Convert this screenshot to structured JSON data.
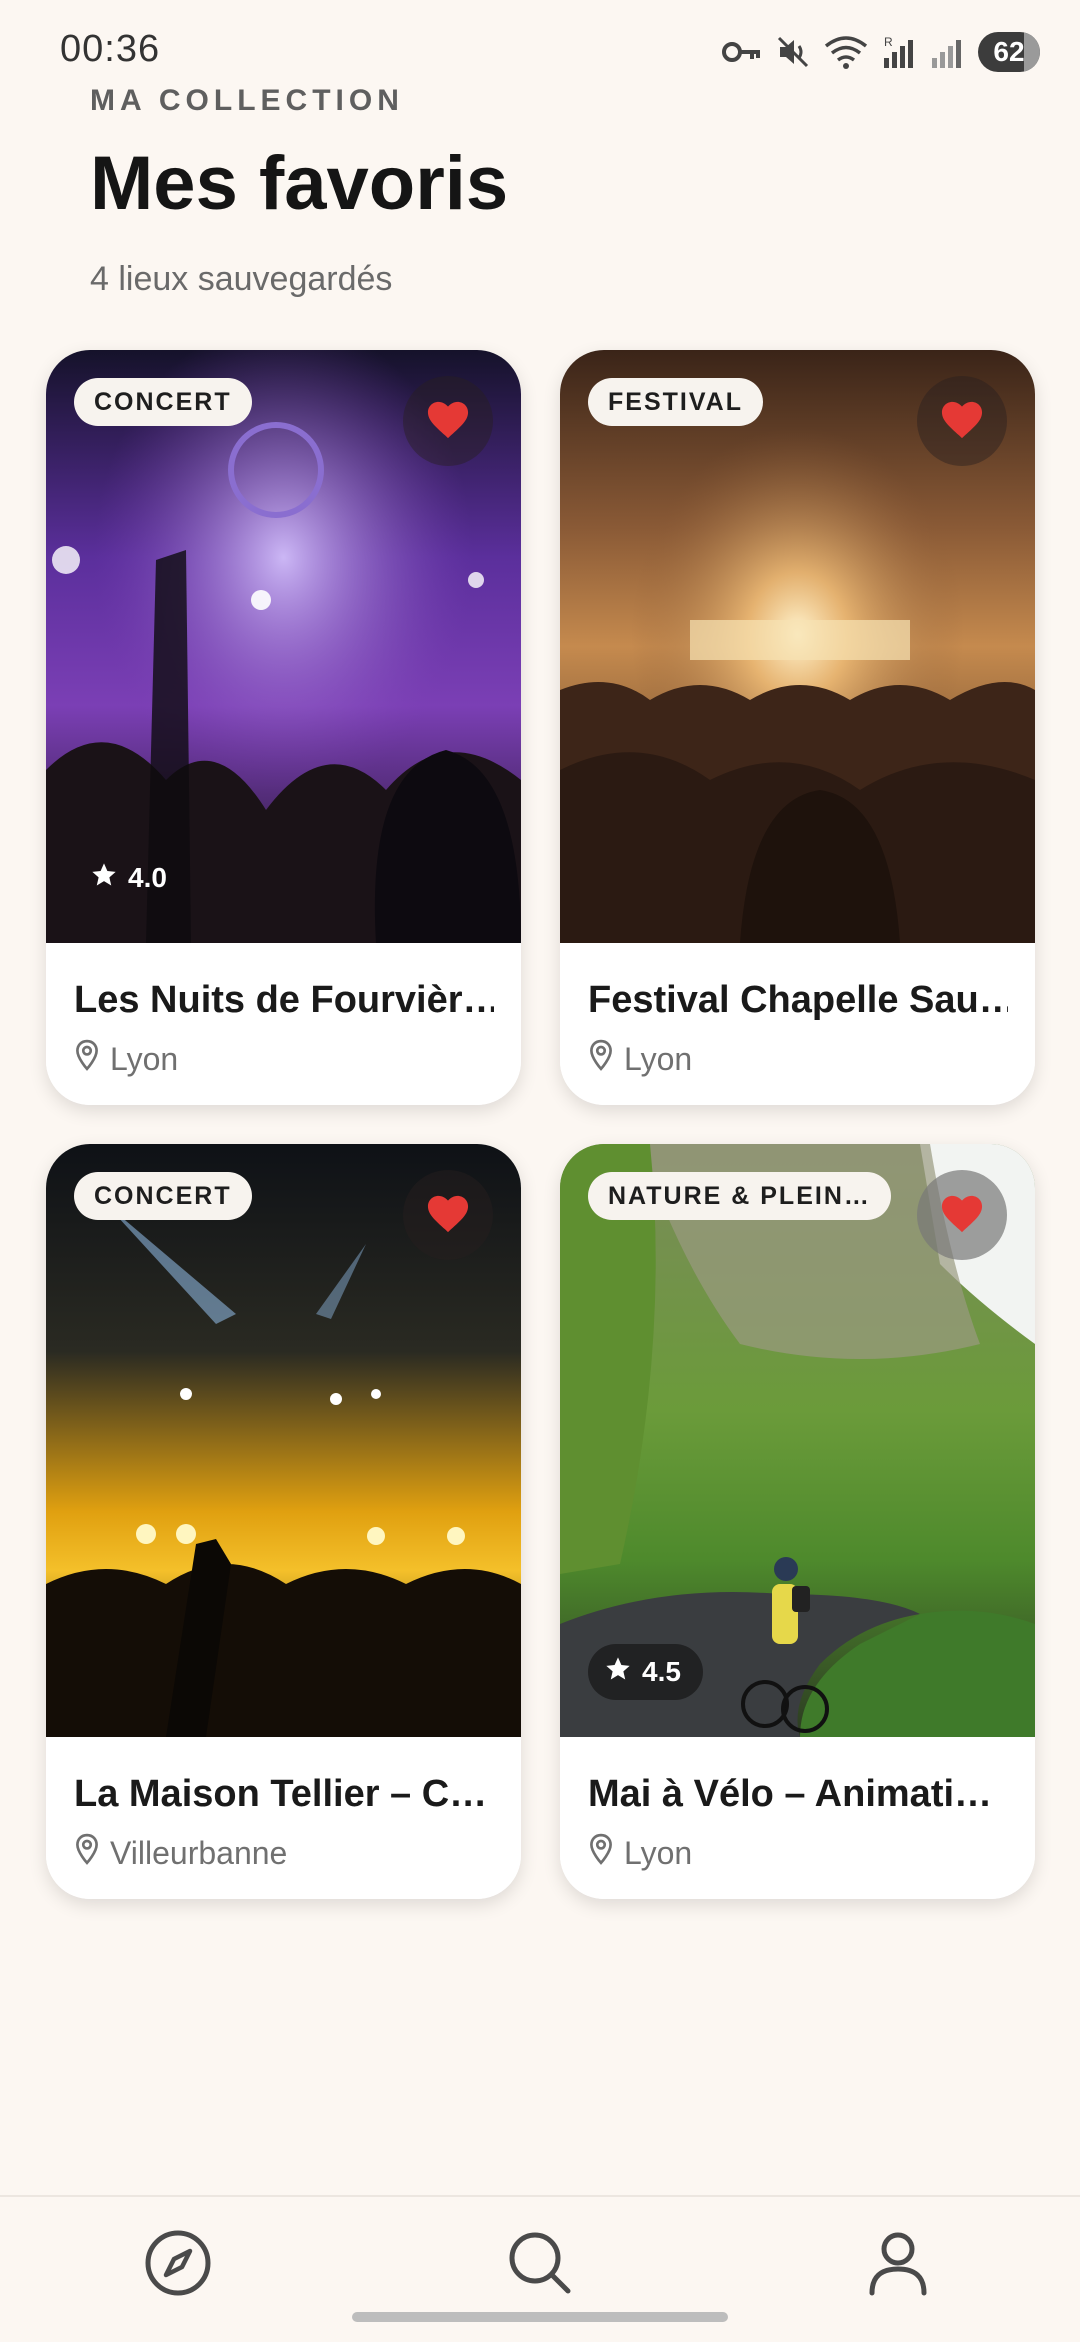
{
  "status_bar": {
    "time": "00:36",
    "battery": "62"
  },
  "header": {
    "eyebrow": "MA COLLECTION",
    "title": "Mes favoris",
    "subtitle": "4 lieux sauvegardés"
  },
  "cards": [
    {
      "category": "CONCERT",
      "name": "Les Nuits de Fourvièr…",
      "location": "Lyon",
      "rating": "4.0",
      "favorited": true
    },
    {
      "category": "FESTIVAL",
      "name": "Festival Chapelle Sau…",
      "location": "Lyon",
      "rating": "",
      "favorited": true
    },
    {
      "category": "CONCERT",
      "name": "La Maison Tellier – C…",
      "location": "Villeurbanne",
      "rating": "",
      "favorited": true
    },
    {
      "category": "NATURE & PLEIN…",
      "name": "Mai à Vélo – Animati…",
      "location": "Lyon",
      "rating": "4.5",
      "favorited": true
    }
  ],
  "bottom_nav": {
    "items": [
      {
        "icon": "compass-icon"
      },
      {
        "icon": "search-icon"
      },
      {
        "icon": "profile-icon"
      }
    ]
  },
  "colors": {
    "heart": "#E53935",
    "background": "#FCF7F2",
    "card": "#FFFFFF"
  }
}
